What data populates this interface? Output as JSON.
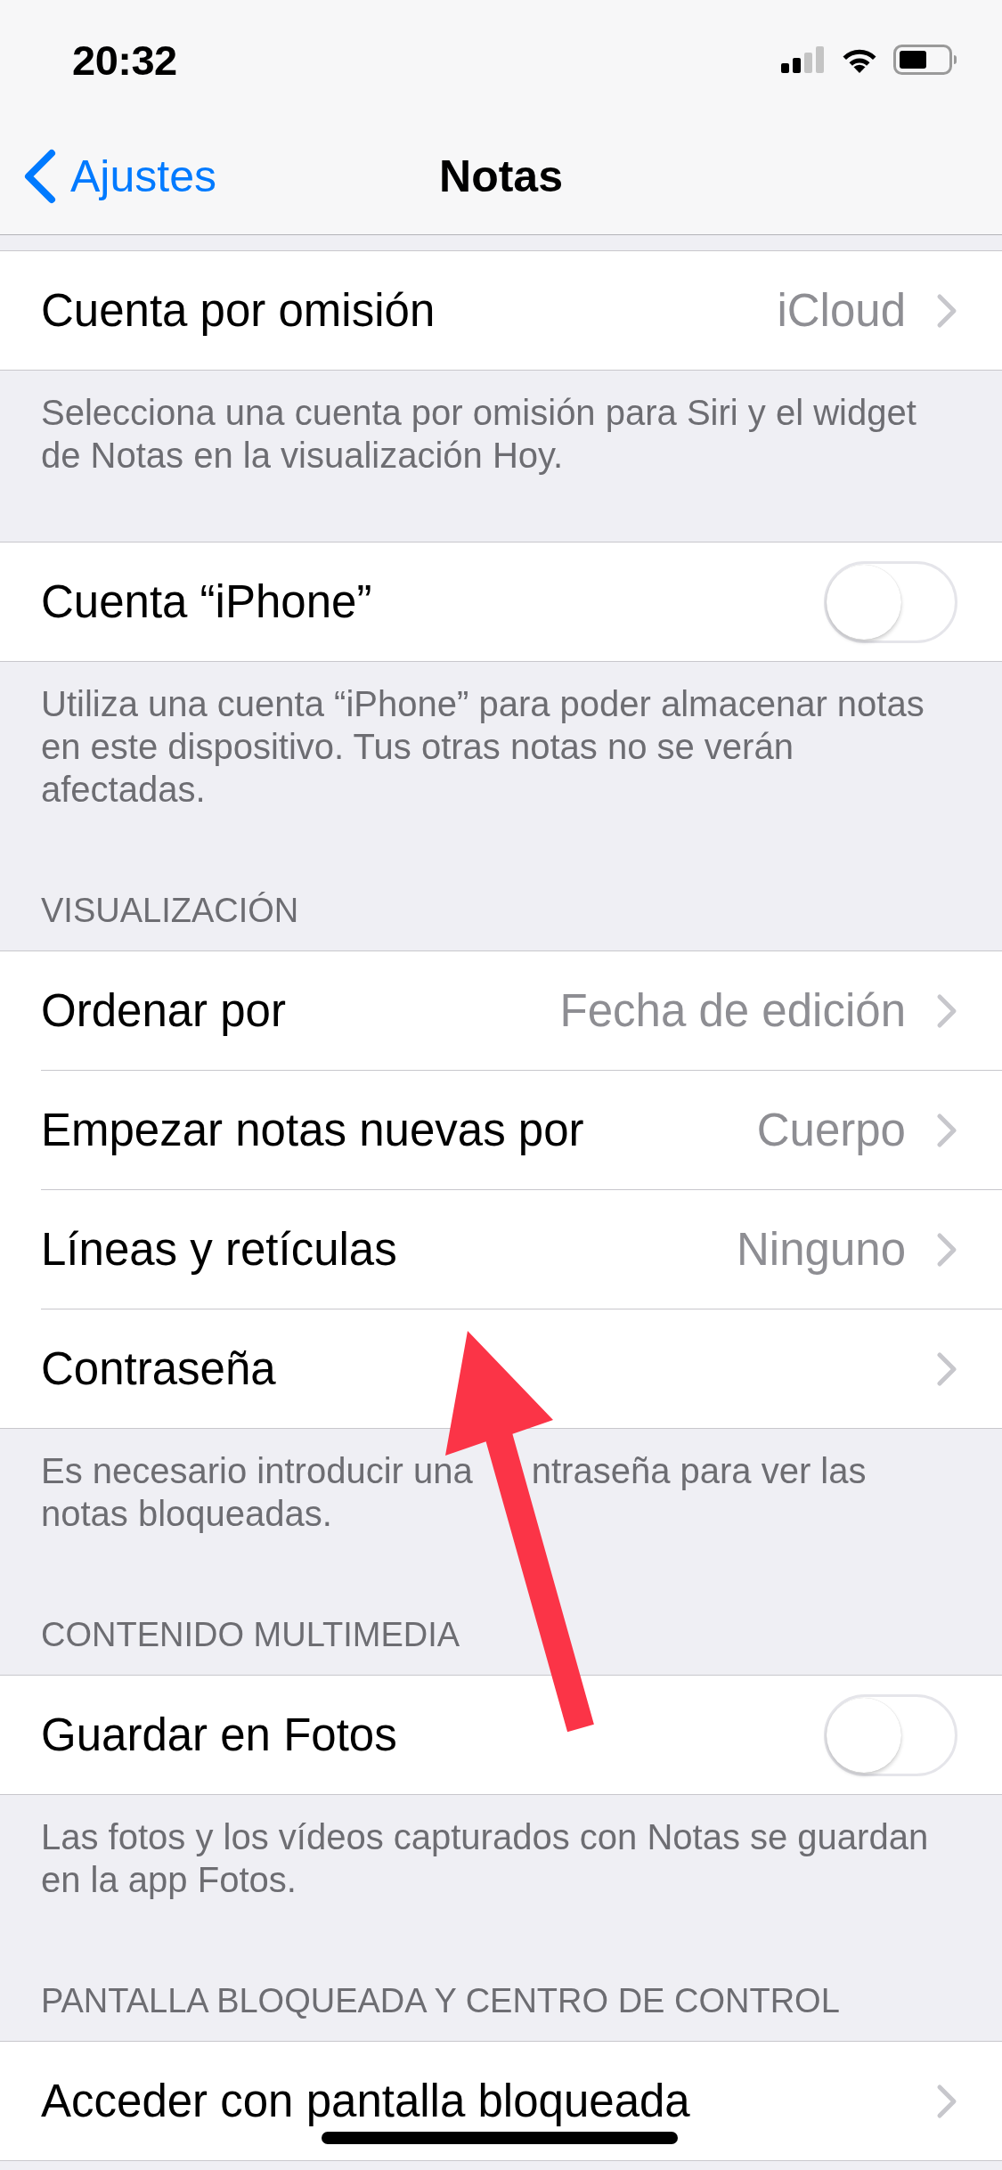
{
  "status_bar": {
    "time": "20:32"
  },
  "nav_bar": {
    "back_label": "Ajustes",
    "title": "Notas"
  },
  "groups": [
    {
      "rows": [
        {
          "kind": "disclosure",
          "label": "Cuenta por omisión",
          "value": "iCloud"
        }
      ],
      "footer": "Selecciona una cuenta por omisión para Siri y el widget de Notas en la visualización Hoy."
    },
    {
      "rows": [
        {
          "kind": "toggle",
          "label": "Cuenta “iPhone”",
          "on": false
        }
      ],
      "footer": "Utiliza una cuenta “iPhone” para poder almacenar notas en este dispositivo. Tus otras notas no se verán afectadas."
    },
    {
      "header": "VISUALIZACIÓN",
      "rows": [
        {
          "kind": "disclosure",
          "label": "Ordenar por",
          "value": "Fecha de edición"
        },
        {
          "kind": "disclosure",
          "label": "Empezar notas nuevas por",
          "value": "Cuerpo"
        },
        {
          "kind": "disclosure",
          "label": "Líneas y retículas",
          "value": "Ninguno"
        },
        {
          "kind": "disclosure",
          "label": "Contraseña"
        }
      ],
      "footer": [
        "Es necesario introducir una",
        "ntraseña para ver las",
        "notas bloqueadas."
      ]
    },
    {
      "header": "CONTENIDO MULTIMEDIA",
      "rows": [
        {
          "kind": "toggle",
          "label": "Guardar en Fotos",
          "on": false
        }
      ],
      "footer": "Las fotos y los vídeos capturados con Notas se guardan en la app Fotos."
    },
    {
      "header": "PANTALLA BLOQUEADA Y CENTRO DE CONTROL",
      "rows": [
        {
          "kind": "disclosure",
          "label": "Acceder con pantalla bloqueada"
        }
      ]
    }
  ],
  "annotations": [
    {
      "kind": "arrow"
    }
  ]
}
